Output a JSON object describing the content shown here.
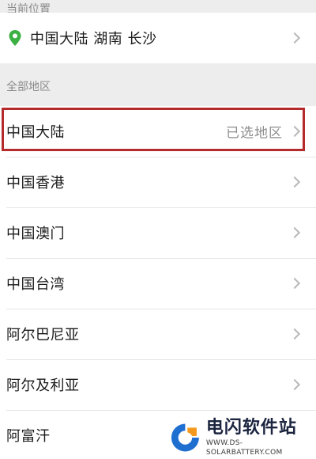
{
  "current_location": {
    "header": "当前位置",
    "value": "中国大陆 湖南 长沙",
    "pin_color": "#3cb043"
  },
  "all_regions": {
    "header": "全部地区",
    "items": [
      {
        "label": "中国大陆",
        "tag": "已选地区"
      },
      {
        "label": "中国香港"
      },
      {
        "label": "中国澳门"
      },
      {
        "label": "中国台湾"
      },
      {
        "label": "阿尔巴尼亚"
      },
      {
        "label": "阿尔及利亚"
      },
      {
        "label": "阿富汗"
      }
    ]
  },
  "highlight_color": "#b52a2a",
  "watermark": {
    "title": "电闪软件站",
    "url": "WWW.DS-SOLARBATTERY.COM"
  }
}
